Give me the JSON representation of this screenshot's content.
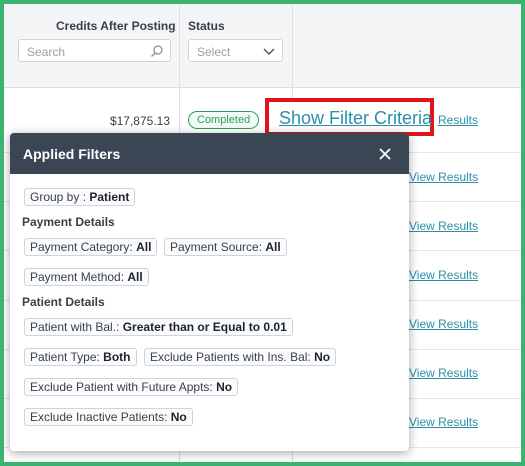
{
  "header": {
    "credits_label": "Credits After Posting",
    "status_label": "Status",
    "search_placeholder": "Search",
    "status_select_value": "Select"
  },
  "row1": {
    "amount": "$17,875.13",
    "status": "Completed",
    "show_filter_criteria": "Show Filter Criteria",
    "view_results_partial": "Results"
  },
  "rows": [
    {
      "view_results": "View Results"
    },
    {
      "view_results": "View Results"
    },
    {
      "view_results": "View Results"
    },
    {
      "view_results": "View Results"
    },
    {
      "view_results": "View Results"
    },
    {
      "view_results": "View Results"
    }
  ],
  "popup": {
    "title": "Applied Filters",
    "group_by": {
      "key": "Group by : ",
      "value": "Patient"
    },
    "payment_details_heading": "Payment Details",
    "payment_category": {
      "key": "Payment Category: ",
      "value": "All"
    },
    "payment_source": {
      "key": "Payment Source: ",
      "value": "All"
    },
    "payment_method": {
      "key": "Payment Method: ",
      "value": "All"
    },
    "patient_details_heading": "Patient Details",
    "patient_with_bal": {
      "key": "Patient with Bal.: ",
      "value": "Greater than or Equal to 0.01"
    },
    "patient_type": {
      "key": "Patient Type: ",
      "value": "Both"
    },
    "exclude_ins_bal": {
      "key": "Exclude Patients with Ins. Bal: ",
      "value": "No"
    },
    "exclude_future_appts": {
      "key": "Exclude Patient with Future Appts: ",
      "value": "No"
    },
    "exclude_inactive": {
      "key": "Exclude Inactive Patients: ",
      "value": "No"
    }
  },
  "colors": {
    "frame": "#3cb371",
    "popup_header": "#3b4654",
    "link": "#2a8fa8",
    "completed": "#2e9e5b",
    "highlight": "#e0141a"
  }
}
